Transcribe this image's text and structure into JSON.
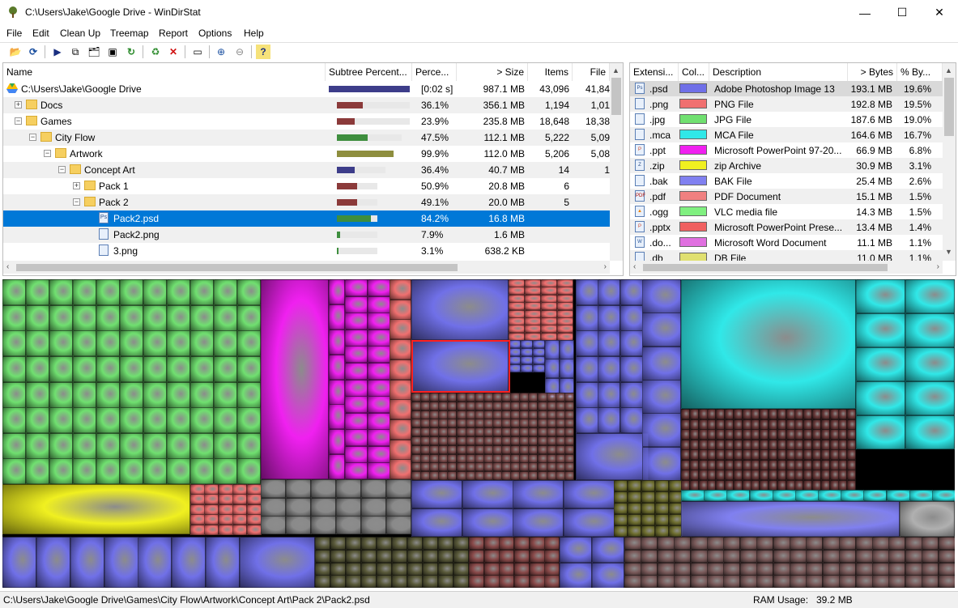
{
  "window": {
    "title": "C:\\Users\\Jake\\Google Drive - WinDirStat",
    "minimize": "—",
    "maximize": "☐",
    "close": "✕"
  },
  "menu": [
    "File",
    "Edit",
    "Clean Up",
    "Treemap",
    "Report",
    "Options",
    "Help"
  ],
  "toolbar": {
    "open": "📂",
    "refresh": "⟳",
    "play": "▶",
    "copy": "⧉",
    "explorer": "🗂",
    "cmd": "▣",
    "refresh_selected": "↻",
    "recycle": "♻",
    "delete": "✕",
    "properties": "▭",
    "zoom_in": "⊕",
    "zoom_out": "⊖",
    "help": "?"
  },
  "tree": {
    "columns": [
      "Name",
      "Subtree Percent...",
      "Perce...",
      "> Size",
      "Items",
      "File"
    ],
    "rows": [
      {
        "name": "C:\\Users\\Jake\\Google Drive",
        "pct": "[0:02 s]",
        "size": "987.1 MB",
        "items": "43,096",
        "files": "41,84",
        "bar": 1.0,
        "bar_color": "#3d3d8a",
        "depth": 0,
        "icon": "drive",
        "expander": ""
      },
      {
        "name": "Docs",
        "pct": "36.1%",
        "size": "356.1 MB",
        "items": "1,194",
        "files": "1,01",
        "bar": 0.361,
        "bar_color": "#8b3a3a",
        "depth": 1,
        "icon": "folder",
        "expander": "+"
      },
      {
        "name": "Games",
        "pct": "23.9%",
        "size": "235.8 MB",
        "items": "18,648",
        "files": "18,38",
        "bar": 0.239,
        "bar_color": "#8b3a3a",
        "depth": 1,
        "icon": "folder",
        "expander": "−"
      },
      {
        "name": "City Flow",
        "pct": "47.5%",
        "size": "112.1 MB",
        "items": "5,222",
        "files": "5,09",
        "bar": 0.475,
        "bar_color": "#3e8e3e",
        "depth": 2,
        "icon": "folder",
        "expander": "−"
      },
      {
        "name": "Artwork",
        "pct": "99.9%",
        "size": "112.0 MB",
        "items": "5,206",
        "files": "5,08",
        "bar": 0.999,
        "bar_color": "#8e8e3e",
        "depth": 3,
        "icon": "folder",
        "expander": "−"
      },
      {
        "name": "Concept Art",
        "pct": "36.4%",
        "size": "40.7 MB",
        "items": "14",
        "files": "1",
        "bar": 0.364,
        "bar_color": "#3d3d8a",
        "depth": 4,
        "icon": "folder",
        "expander": "−"
      },
      {
        "name": "Pack 1",
        "pct": "50.9%",
        "size": "20.8 MB",
        "items": "6",
        "files": "",
        "bar": 0.509,
        "bar_color": "#8b3a3a",
        "depth": 5,
        "icon": "folder",
        "expander": "+"
      },
      {
        "name": "Pack 2",
        "pct": "49.1%",
        "size": "20.0 MB",
        "items": "5",
        "files": "",
        "bar": 0.491,
        "bar_color": "#8b3a3a",
        "depth": 5,
        "icon": "folder",
        "expander": "−"
      },
      {
        "name": "Pack2.psd",
        "pct": "84.2%",
        "size": "16.8 MB",
        "items": "",
        "files": "",
        "bar": 0.842,
        "bar_color": "#3e8e3e",
        "depth": 6,
        "icon": "Ps",
        "expander": "",
        "selected": true
      },
      {
        "name": "Pack2.png",
        "pct": "7.9%",
        "size": "1.6 MB",
        "items": "",
        "files": "",
        "bar": 0.079,
        "bar_color": "#3e8e3e",
        "depth": 6,
        "icon": "img",
        "expander": ""
      },
      {
        "name": "3.png",
        "pct": "3.1%",
        "size": "638.2 KB",
        "items": "",
        "files": "",
        "bar": 0.031,
        "bar_color": "#3e8e3e",
        "depth": 6,
        "icon": "img",
        "expander": ""
      }
    ]
  },
  "extensions": {
    "columns": [
      "Extensi...",
      "Col...",
      "Description",
      "> Bytes",
      "% By..."
    ],
    "rows": [
      {
        "ext": ".psd",
        "color": "#7070e8",
        "desc": "Adobe Photoshop Image 13",
        "bytes": "193.1 MB",
        "pct": "19.6%",
        "icon": "Ps",
        "selected": true
      },
      {
        "ext": ".png",
        "color": "#f07070",
        "desc": "PNG File",
        "bytes": "192.8 MB",
        "pct": "19.5%",
        "icon": "img"
      },
      {
        "ext": ".jpg",
        "color": "#70e070",
        "desc": "JPG File",
        "bytes": "187.6 MB",
        "pct": "19.0%",
        "icon": "img"
      },
      {
        "ext": ".mca",
        "color": "#30e8e8",
        "desc": "MCA File",
        "bytes": "164.6 MB",
        "pct": "16.7%",
        "icon": "doc"
      },
      {
        "ext": ".ppt",
        "color": "#f020f0",
        "desc": "Microsoft PowerPoint 97-20...",
        "bytes": "66.9 MB",
        "pct": "6.8%",
        "icon": "P"
      },
      {
        "ext": ".zip",
        "color": "#f0f020",
        "desc": "zip Archive",
        "bytes": "30.9 MB",
        "pct": "3.1%",
        "icon": "Z"
      },
      {
        "ext": ".bak",
        "color": "#8080f0",
        "desc": "BAK File",
        "bytes": "25.4 MB",
        "pct": "2.6%",
        "icon": "doc"
      },
      {
        "ext": ".pdf",
        "color": "#f08080",
        "desc": "PDF Document",
        "bytes": "15.1 MB",
        "pct": "1.5%",
        "icon": "PDF"
      },
      {
        "ext": ".ogg",
        "color": "#80f080",
        "desc": "VLC media file",
        "bytes": "14.3 MB",
        "pct": "1.5%",
        "icon": "▲"
      },
      {
        "ext": ".pptx",
        "color": "#f06060",
        "desc": "Microsoft PowerPoint Prese...",
        "bytes": "13.4 MB",
        "pct": "1.4%",
        "icon": "P"
      },
      {
        "ext": ".do...",
        "color": "#e070e0",
        "desc": "Microsoft Word Document",
        "bytes": "11.1 MB",
        "pct": "1.1%",
        "icon": "W"
      },
      {
        "ext": ".db",
        "color": "#e0e070",
        "desc": "DB File",
        "bytes": "11.0 MB",
        "pct": "1.1%",
        "icon": "doc"
      }
    ]
  },
  "status": {
    "path": "C:\\Users\\Jake\\Google Drive\\Games\\City Flow\\Artwork\\Concept Art\\Pack 2\\Pack2.psd",
    "ram_label": "RAM Usage:",
    "ram_value": "39.2 MB"
  },
  "colors": {
    "selection": "#0078d7",
    "treemap_highlight": "#ff2020"
  }
}
